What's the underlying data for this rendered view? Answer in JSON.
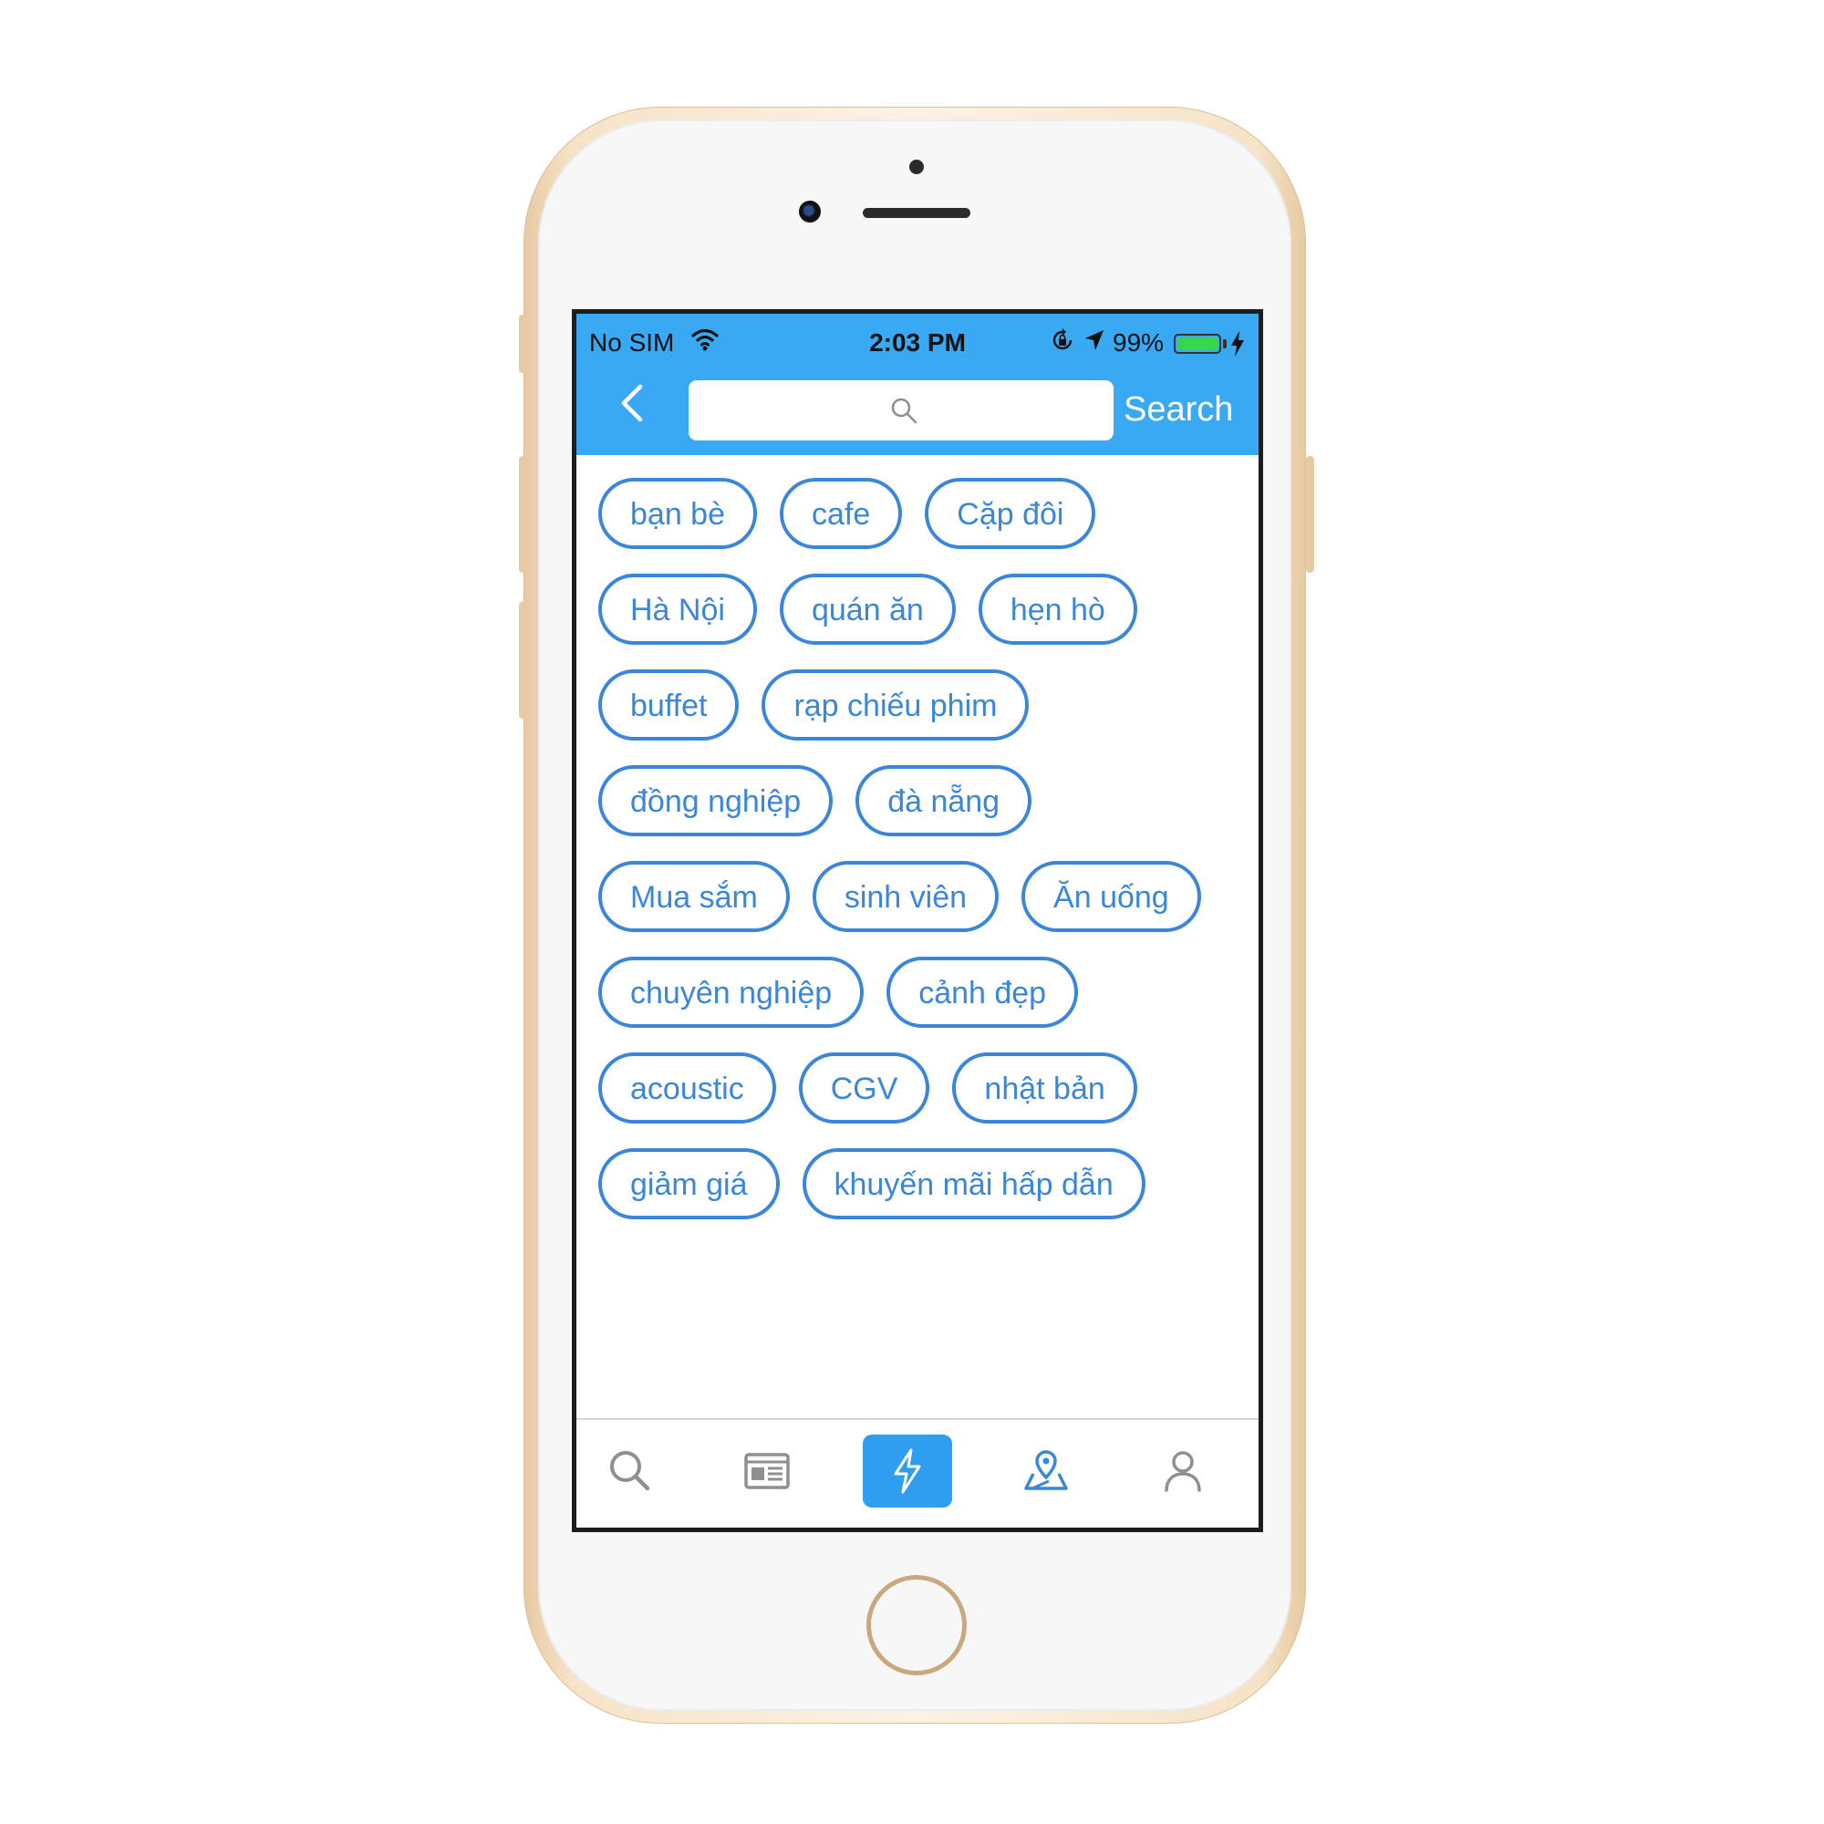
{
  "status_bar": {
    "carrier": "No SIM",
    "time": "2:03 PM",
    "battery_percent": "99%",
    "battery_level": 0.99,
    "icons": [
      "wifi-icon",
      "orientation-lock-icon",
      "location-arrow-icon",
      "battery-icon",
      "charging-bolt-icon"
    ]
  },
  "header": {
    "back_icon": "chevron-left-icon",
    "search_placeholder": "",
    "search_icon": "magnifier-icon",
    "search_button_label": "Search"
  },
  "tags": {
    "rows": [
      [
        {
          "label": "bạn bè"
        },
        {
          "label": "cafe"
        },
        {
          "label": "Cặp đôi"
        }
      ],
      [
        {
          "label": "Hà Nội"
        },
        {
          "label": "quán ăn"
        },
        {
          "label": "hẹn hò"
        }
      ],
      [
        {
          "label": "buffet"
        },
        {
          "label": "rạp chiếu phim"
        }
      ],
      [
        {
          "label": "đồng nghiệp"
        },
        {
          "label": "đà nẵng"
        }
      ],
      [
        {
          "label": "Mua sắm"
        },
        {
          "label": "sinh viên"
        },
        {
          "label": "Ăn uống"
        }
      ],
      [
        {
          "label": "chuyên nghiệp"
        },
        {
          "label": "cảnh đẹp"
        }
      ],
      [
        {
          "label": "acoustic"
        },
        {
          "label": "CGV"
        },
        {
          "label": "nhật bản"
        }
      ],
      [
        {
          "label": "giảm giá"
        },
        {
          "label": "khuyến mãi hấp dẫn"
        }
      ]
    ]
  },
  "tab_bar": {
    "tabs": [
      {
        "icon": "search-icon",
        "active": false
      },
      {
        "icon": "newspaper-icon",
        "active": false
      },
      {
        "icon": "lightning-icon",
        "active": true
      },
      {
        "icon": "map-pin-icon",
        "active": false
      },
      {
        "icon": "user-icon",
        "active": false
      }
    ]
  },
  "colors": {
    "header_blue": "#3aa9f4",
    "tag_blue": "#3a86d9",
    "active_tab": "#2e9ef0",
    "phone_gold": "#e7c9a2"
  }
}
